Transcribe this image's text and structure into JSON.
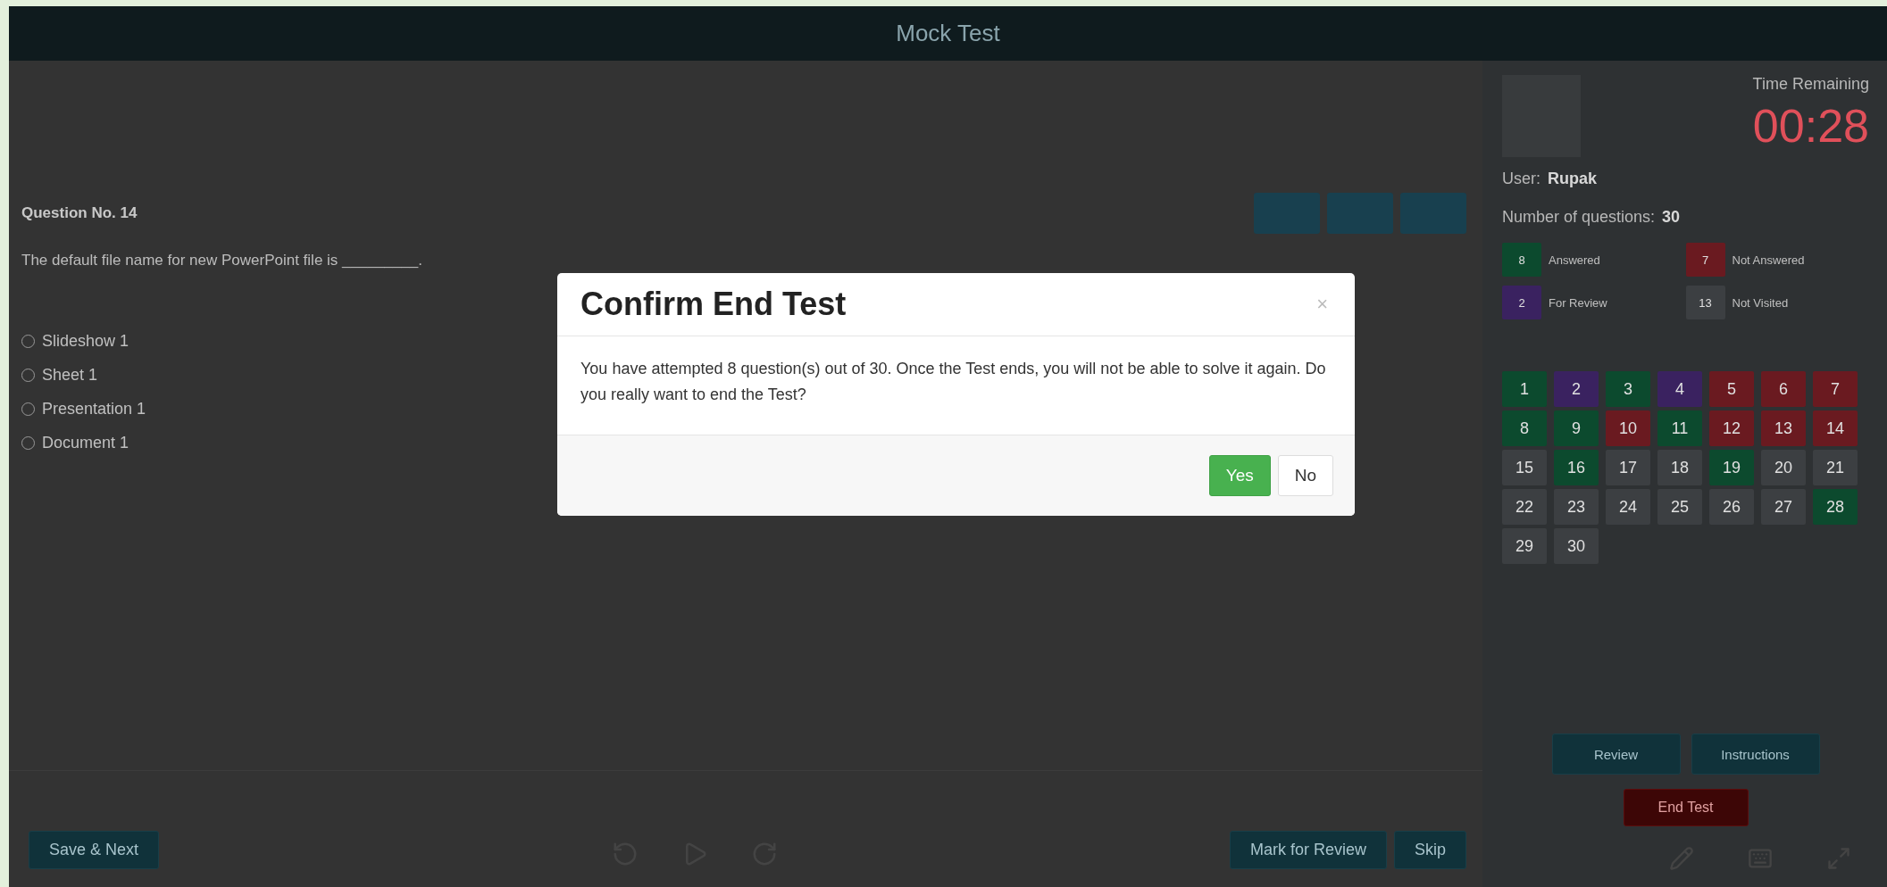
{
  "header": {
    "title": "Mock Test"
  },
  "question": {
    "number": "Question No. 14",
    "text": "The default file name for new PowerPoint file is _________.",
    "options": [
      {
        "label": "Slideshow 1",
        "selected": false
      },
      {
        "label": "Sheet 1",
        "selected": false
      },
      {
        "label": "Presentation 1",
        "selected": false
      },
      {
        "label": "Document 1",
        "selected": false
      }
    ]
  },
  "side": {
    "time_label": "Time Remaining",
    "time": "00:28",
    "user_label": "User:",
    "user": "Rupak",
    "count_label": "Number of questions:",
    "count": "30",
    "legend": [
      {
        "color": "#0c4a2e",
        "count": "8",
        "label": "Answered"
      },
      {
        "color": "#6a1a20",
        "count": "7",
        "label": "Not Answered"
      },
      {
        "color": "#3a2260",
        "count": "2",
        "label": "For Review"
      },
      {
        "color": "#3c3f42",
        "count": "13",
        "label": "Not Visited"
      }
    ],
    "questions": [
      {
        "number": "1",
        "color": "#0c4a2e"
      },
      {
        "number": "2",
        "color": "#3a2260"
      },
      {
        "number": "3",
        "color": "#0c4a2e"
      },
      {
        "number": "4",
        "color": "#3a2260"
      },
      {
        "number": "5",
        "color": "#6a1a20"
      },
      {
        "number": "6",
        "color": "#6a1a20"
      },
      {
        "number": "7",
        "color": "#6a1a20"
      },
      {
        "number": "8",
        "color": "#0c4a2e"
      },
      {
        "number": "9",
        "color": "#0c4a2e"
      },
      {
        "number": "10",
        "color": "#6a1a20"
      },
      {
        "number": "11",
        "color": "#0c4a2e"
      },
      {
        "number": "12",
        "color": "#6a1a20"
      },
      {
        "number": "13",
        "color": "#6a1a20"
      },
      {
        "number": "14",
        "color": "#6a1a20"
      },
      {
        "number": "15",
        "color": "#3c3f42"
      },
      {
        "number": "16",
        "color": "#0c4a2e"
      },
      {
        "number": "17",
        "color": "#3c3f42"
      },
      {
        "number": "18",
        "color": "#3c3f42"
      },
      {
        "number": "19",
        "color": "#0c4a2e"
      },
      {
        "number": "20",
        "color": "#3c3f42"
      },
      {
        "number": "21",
        "color": "#3c3f42"
      },
      {
        "number": "22",
        "color": "#3c3f42"
      },
      {
        "number": "23",
        "color": "#3c3f42"
      },
      {
        "number": "24",
        "color": "#3c3f42"
      },
      {
        "number": "25",
        "color": "#3c3f42"
      },
      {
        "number": "26",
        "color": "#3c3f42"
      },
      {
        "number": "27",
        "color": "#3c3f42"
      },
      {
        "number": "28",
        "color": "#0c4a2e"
      },
      {
        "number": "29",
        "color": "#3c3f42"
      },
      {
        "number": "30",
        "color": "#3c3f42"
      }
    ],
    "buttons": [
      "Review",
      "Instructions"
    ],
    "end_button": "End Test"
  },
  "footer": {
    "save": "Save & Next",
    "mark": "Mark for Review",
    "skip": "Skip"
  },
  "dialog": {
    "title": "Confirm End Test",
    "close": "×",
    "message": "You have attempted 8 question(s) out of 30. Once the Test ends, you will not be able to solve it again. Do you really want to end the Test?",
    "buttons": [
      {
        "label": "Yes",
        "kind": "primary"
      },
      {
        "label": "No",
        "kind": "default"
      }
    ]
  }
}
